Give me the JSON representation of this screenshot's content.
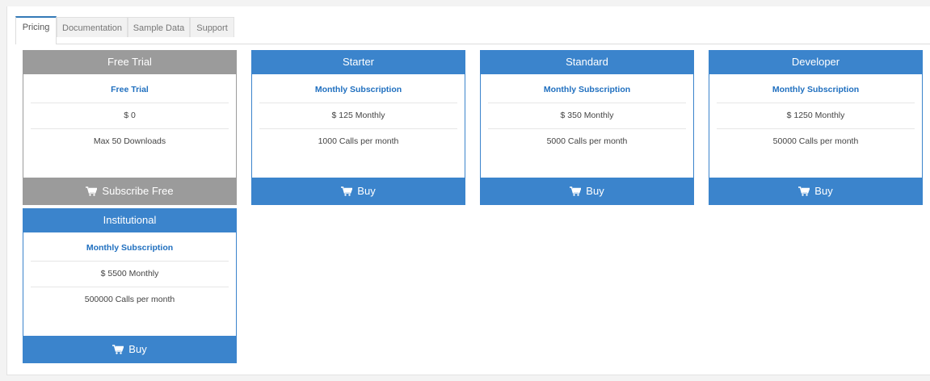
{
  "tabs": [
    {
      "label": "Pricing",
      "active": true
    },
    {
      "label": "Documentation",
      "active": false
    },
    {
      "label": "Sample Data",
      "active": false
    },
    {
      "label": "Support",
      "active": false
    }
  ],
  "colors": {
    "accent_blue": "#3b84cc",
    "trial_grey": "#9b9b9b",
    "plan_name_blue": "#1f6fbf"
  },
  "plans": [
    {
      "title": "Free Trial",
      "plan_name": "Free Trial",
      "price": "$ 0",
      "limit": "Max 50 Downloads",
      "button": "Subscribe Free",
      "button_icon": "cart-icon"
    },
    {
      "title": "Starter",
      "plan_name": "Monthly Subscription",
      "price": "$ 125 Monthly",
      "limit": "1000 Calls per month",
      "button": "Buy",
      "button_icon": "cart-icon"
    },
    {
      "title": "Standard",
      "plan_name": "Monthly Subscription",
      "price": "$ 350 Monthly",
      "limit": "5000 Calls per month",
      "button": "Buy",
      "button_icon": "cart-icon"
    },
    {
      "title": "Developer",
      "plan_name": "Monthly Subscription",
      "price": "$ 1250 Monthly",
      "limit": "50000 Calls per month",
      "button": "Buy",
      "button_icon": "cart-icon"
    },
    {
      "title": "Institutional",
      "plan_name": "Monthly Subscription",
      "price": "$ 5500 Monthly",
      "limit": "500000 Calls per month",
      "button": "Buy",
      "button_icon": "cart-icon"
    }
  ]
}
